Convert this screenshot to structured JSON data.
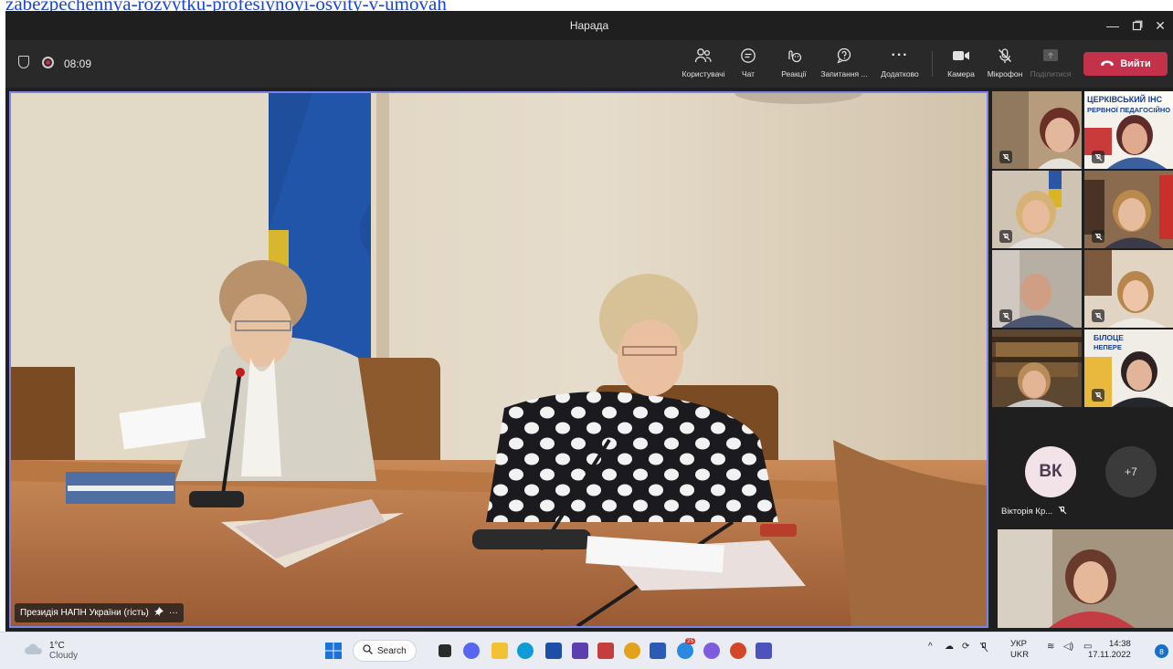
{
  "browser_link": "zabezpechennya-rozvytku-profesiynoyi-osvity-v-umovah",
  "window": {
    "title": "Нарада"
  },
  "meeting": {
    "elapsed": "08:09",
    "toolbar": [
      {
        "label": "Користувачі",
        "icon": "people-icon"
      },
      {
        "label": "Чат",
        "icon": "chat-icon"
      },
      {
        "label": "Реакції",
        "icon": "reactions-icon"
      },
      {
        "label": "Запитання ...",
        "icon": "qna-icon"
      },
      {
        "label": "Додатково",
        "icon": "more-icon"
      },
      {
        "label": "Камера",
        "icon": "camera-icon"
      },
      {
        "label": "Мікрофон",
        "icon": "mic-off-icon"
      },
      {
        "label": "Поділитися",
        "icon": "share-icon",
        "disabled": true
      }
    ],
    "leave_label": "Вийти",
    "leave_color": "#c4314b",
    "active_border_color": "#7b83eb"
  },
  "main_video": {
    "speaker_label": "Президія НАПН України (гість)",
    "sign_top": "ЦЕРКІВСЬКИЙ ІНС",
    "sign_bottom": "РЕРВНОЇ ПЕДАГОСІЙНО"
  },
  "gallery": {
    "tile_sign_top": "БІЛОЦЕ",
    "tile_sign_bottom": "НЕПЕРЕ",
    "avatar_initials": "ВК",
    "avatar_name": "Вікторія Кр...",
    "overflow_count": "+7"
  },
  "taskbar": {
    "weather_temp": "1°C",
    "weather_desc": "Cloudy",
    "search_label": "Search",
    "lang_top": "УКР",
    "lang_bottom": "UKR",
    "time": "14:38",
    "date": "17.11.2022",
    "notification_count": "8",
    "mail_badge": "25"
  }
}
